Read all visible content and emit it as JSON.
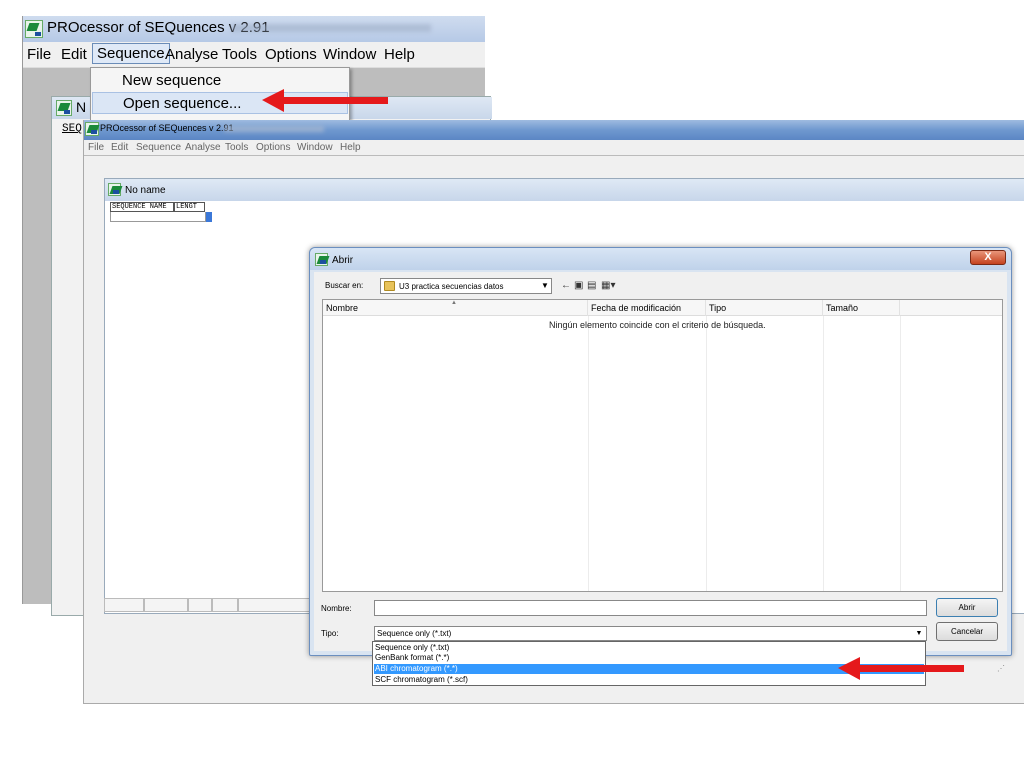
{
  "back_window": {
    "title": "PROcessor of SEQuences v 2.91",
    "menu": [
      "File",
      "Edit",
      "Sequence",
      "Analyse",
      "Tools",
      "Options",
      "Window",
      "Help"
    ],
    "sequence_menu": [
      "New sequence",
      "Open sequence..."
    ],
    "child_title": "N",
    "child_column": "SEQ"
  },
  "front_window": {
    "title": "PROcessor of SEQuences v 2.91",
    "menu": [
      "File",
      "Edit",
      "Sequence",
      "Analyse",
      "Tools",
      "Options",
      "Window",
      "Help"
    ],
    "child_title": "No name",
    "grid_headers": [
      "SEQUENCE NAME",
      "LENGT"
    ]
  },
  "dialog": {
    "title": "Abrir",
    "close_label": "X",
    "look_in_label": "Buscar en:",
    "look_in_value": "U3 practica secuencias datos",
    "columns": [
      "Nombre",
      "Fecha de modificación",
      "Tipo",
      "Tamaño"
    ],
    "empty_message": "Ningún elemento coincide con el criterio de búsqueda.",
    "name_label": "Nombre:",
    "name_value": "",
    "type_label": "Tipo:",
    "type_value": "Sequence only (*.txt)",
    "type_options": [
      "Sequence only (*.txt)",
      "GenBank format (*.*)",
      "ABI chromatogram (*.*)",
      "SCF chromatogram (*.scf)"
    ],
    "type_selected_index": 2,
    "open_button": "Abrir",
    "cancel_button": "Cancelar"
  },
  "icons": {
    "app": "app-icon",
    "folder": "folder-icon",
    "dropdown": "chevron-down-icon",
    "back": "back-arrow-icon",
    "up": "up-folder-icon",
    "new_folder": "new-folder-icon",
    "views": "views-menu-icon"
  },
  "colors": {
    "annotation_arrow": "#e5191b",
    "selection": "#3399ff",
    "titlebar": "#6f98cf"
  }
}
